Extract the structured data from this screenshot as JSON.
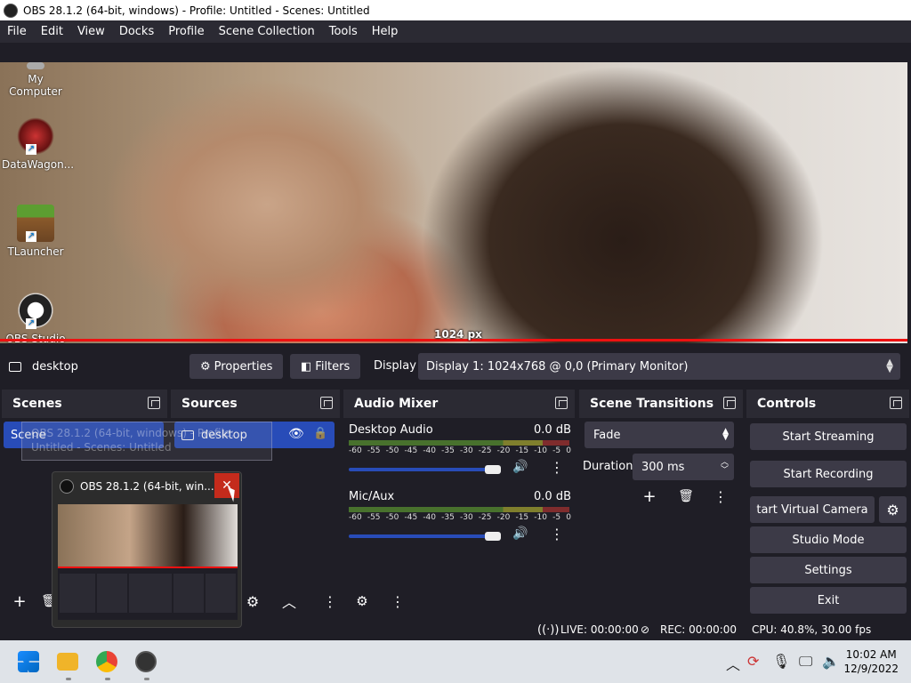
{
  "window": {
    "title": "OBS 28.1.2 (64-bit, windows) - Profile: Untitled - Scenes: Untitled"
  },
  "menu": [
    "File",
    "Edit",
    "View",
    "Docks",
    "Profile",
    "Scene Collection",
    "Tools",
    "Help"
  ],
  "desktop_icons": [
    "My Computer",
    "DataWagon...",
    "TLauncher",
    "OBS Studio"
  ],
  "preview": {
    "size_label": "1024 px"
  },
  "source_bar": {
    "source_name": "desktop",
    "properties_label": "Properties",
    "filters_label": "Filters",
    "display_label": "Display",
    "display_value": "Display 1: 1024x768 @ 0,0 (Primary Monitor)"
  },
  "scenes": {
    "title": "Scenes",
    "items": [
      "Scene"
    ]
  },
  "sources": {
    "title": "Sources",
    "items": [
      "desktop"
    ]
  },
  "audio_mixer": {
    "title": "Audio Mixer",
    "ticks": [
      "-60",
      "-55",
      "-50",
      "-45",
      "-40",
      "-35",
      "-30",
      "-25",
      "-20",
      "-15",
      "-10",
      "-5",
      "0"
    ],
    "channels": [
      {
        "name": "Desktop Audio",
        "level": "0.0 dB",
        "volume": 0.95
      },
      {
        "name": "Mic/Aux",
        "level": "0.0 dB",
        "volume": 0.95
      }
    ]
  },
  "scene_transitions": {
    "title": "Scene Transitions",
    "transition": "Fade",
    "duration_label": "Duration",
    "duration_value": "300 ms"
  },
  "controls": {
    "title": "Controls",
    "start_streaming": "Start Streaming",
    "start_recording": "Start Recording",
    "start_virtual_camera": "tart Virtual Camera",
    "studio_mode": "Studio Mode",
    "settings": "Settings",
    "exit": "Exit"
  },
  "status": {
    "live": "LIVE: 00:00:00",
    "rec": "REC: 00:00:00",
    "cpu": "CPU: 40.8%, 30.00 fps"
  },
  "taskbar_thumbnail": {
    "title": "OBS 28.1.2 (64-bit, win...",
    "drag_ghost": "OBS 28.1.2 (64-bit, windows) - Profile: Untitled - Scenes: Untitled"
  },
  "clock": {
    "time": "10:02 AM",
    "date": "12/9/2022"
  },
  "colors": {
    "accent": "#284cb8",
    "panel": "#2b2a33",
    "background": "#1f1e26",
    "close_red": "#c42b1c"
  }
}
